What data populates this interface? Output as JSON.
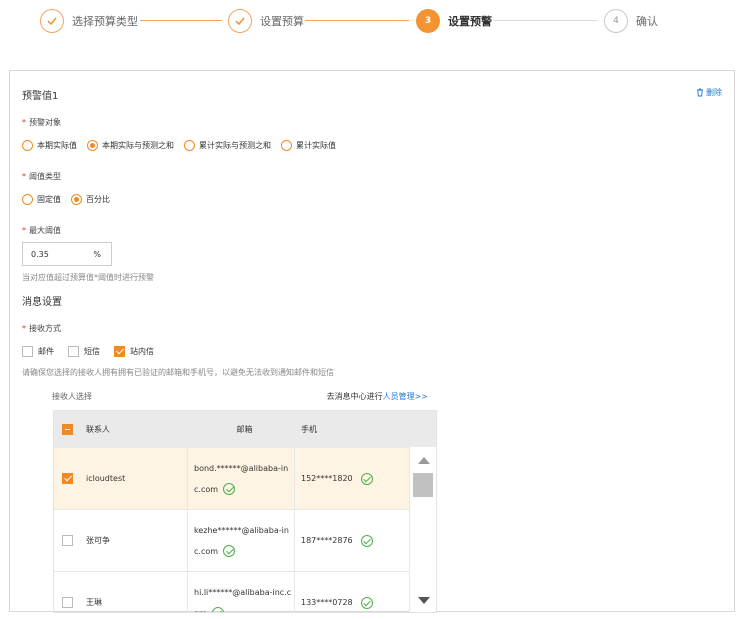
{
  "steps": [
    {
      "label": "选择预算类型",
      "state": "done"
    },
    {
      "label": "设置预算",
      "state": "done"
    },
    {
      "label": "设置预警",
      "state": "active",
      "number": "3"
    },
    {
      "label": "确认",
      "state": "todo",
      "number": "4"
    }
  ],
  "panel": {
    "title": "预警值1",
    "delete_label": "删除"
  },
  "warn_target": {
    "label": "预警对象",
    "options": [
      "本期实际值",
      "本期实际与预测之和",
      "累计实际与预测之和",
      "累计实际值"
    ],
    "selected": "本期实际与预测之和"
  },
  "threshold_type": {
    "label": "阈值类型",
    "options": [
      "固定值",
      "百分比"
    ],
    "selected": "百分比"
  },
  "max_threshold": {
    "label": "最大阈值",
    "value": "0.35",
    "unit": "%",
    "hint": "当对应值超过预算值*阈值时进行预警"
  },
  "message_settings": {
    "title": "消息设置",
    "receive_label": "接收方式",
    "channels": [
      {
        "label": "邮件",
        "checked": false
      },
      {
        "label": "短信",
        "checked": false
      },
      {
        "label": "站内信",
        "checked": true
      }
    ],
    "hint": "请确保您选择的接收人拥有拥有已验证的邮箱和手机号，以避免无法收到通知邮件和短信"
  },
  "recipients": {
    "title": "接收人选择",
    "manage_prefix": "去消息中心进行",
    "manage_link": "人员管理>>",
    "columns": [
      "联系人",
      "邮箱",
      "手机"
    ],
    "rows": [
      {
        "name": "icloudtest",
        "email_line1": "bond.******@alibaba-in",
        "email_line2": "c.com",
        "phone": "152****1820",
        "selected": true
      },
      {
        "name": "张可争",
        "email_line1": "kezhe******@alibaba-in",
        "email_line2": "c.com",
        "phone": "187****2876",
        "selected": false
      },
      {
        "name": "王琳",
        "email_line1": "hi.li******@alibaba-inc.c",
        "email_line2": "om",
        "phone": "133****0728",
        "selected": false
      }
    ]
  }
}
